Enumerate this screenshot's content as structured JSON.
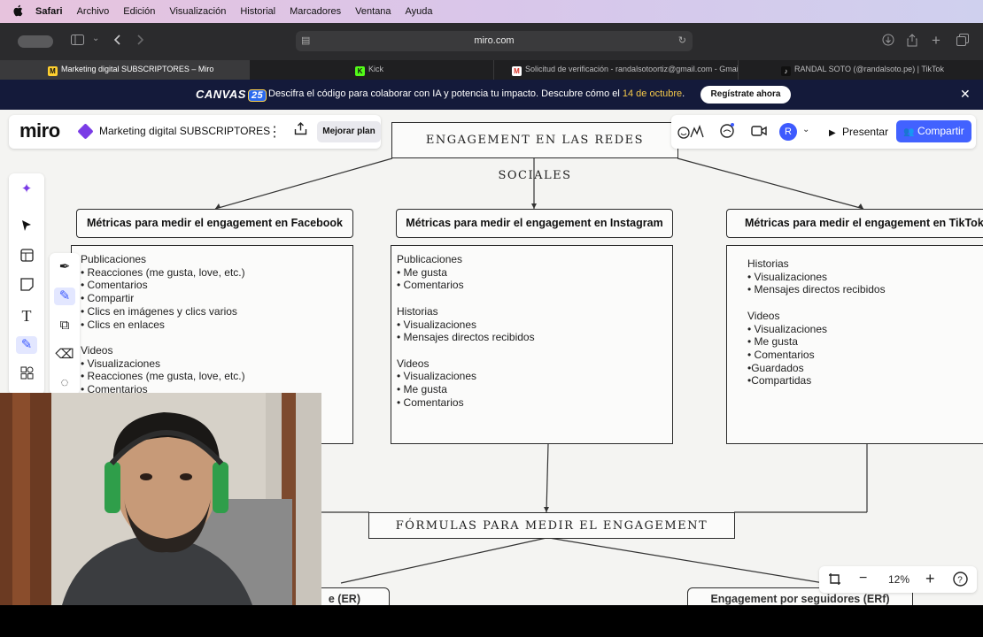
{
  "menubar": {
    "app": "Safari",
    "items": [
      "Archivo",
      "Edición",
      "Visualización",
      "Historial",
      "Marcadores",
      "Ventana",
      "Ayuda"
    ]
  },
  "toolbar": {
    "url": "miro.com"
  },
  "tabs": [
    {
      "label": "Marketing digital SUBSCRIPTORES – Miro",
      "icon": "miro-icon",
      "active": true
    },
    {
      "label": "Kick",
      "icon": "kick-icon",
      "active": false
    },
    {
      "label": "Solicitud de verificación - randalsotoortiz@gmail.com - Gmail",
      "icon": "gmail-icon",
      "active": false
    },
    {
      "label": "RANDAL SOTO (@randalsoto.pe) | TikTok",
      "icon": "tiktok-icon",
      "active": false
    }
  ],
  "banner": {
    "brand": "CANVAS",
    "badge": "25",
    "text_before": "Descifra el código para colaborar con IA y potencia tu impacto. Descubre cómo el ",
    "date": "14 de octubre",
    "text_after": ".",
    "cta": "Regístrate ahora"
  },
  "miro": {
    "logo": "miro",
    "board_name": "Marketing digital SUBSCRIPTORES",
    "upgrade": "Mejorar plan",
    "avatar": "R",
    "present": "Presentar",
    "share": "Compartir",
    "zoom": "12%"
  },
  "board": {
    "title": "ENGAGEMENT EN LAS REDES SOCIALES",
    "formulas_title": "FÓRMULAS PARA MEDIR EL ENGAGEMENT",
    "facebook_head": "Métricas para medir el engagement en Facebook",
    "instagram_head": "Métricas para medir el engagement en Instagram",
    "tiktok_head": "Métricas para medir el engagement en TikTok",
    "facebook_body": "Publicaciones\n• Reacciones (me gusta, love, etc.)\n• Comentarios\n• Compartir\n• Clics en imágenes y clics varios\n• Clics en enlaces\n\nVideos\n• Visualizaciones\n• Reacciones (me gusta, love, etc.)\n• Comentarios",
    "instagram_body": "Publicaciones\n• Me gusta\n• Comentarios\n\nHistorias\n• Visualizaciones\n• Mensajes directos recibidos\n\nVideos\n• Visualizaciones\n• Me gusta\n• Comentarios",
    "tiktok_body": "Historias\n• Visualizaciones\n• Mensajes directos recibidos\n\nVideos\n• Visualizaciones\n• Me gusta\n• Comentarios\n•Guardados\n•Compartidas",
    "bottom_left_partial": "e (ER)",
    "bottom_right_partial": "Engagement por seguidores (ERf)"
  }
}
